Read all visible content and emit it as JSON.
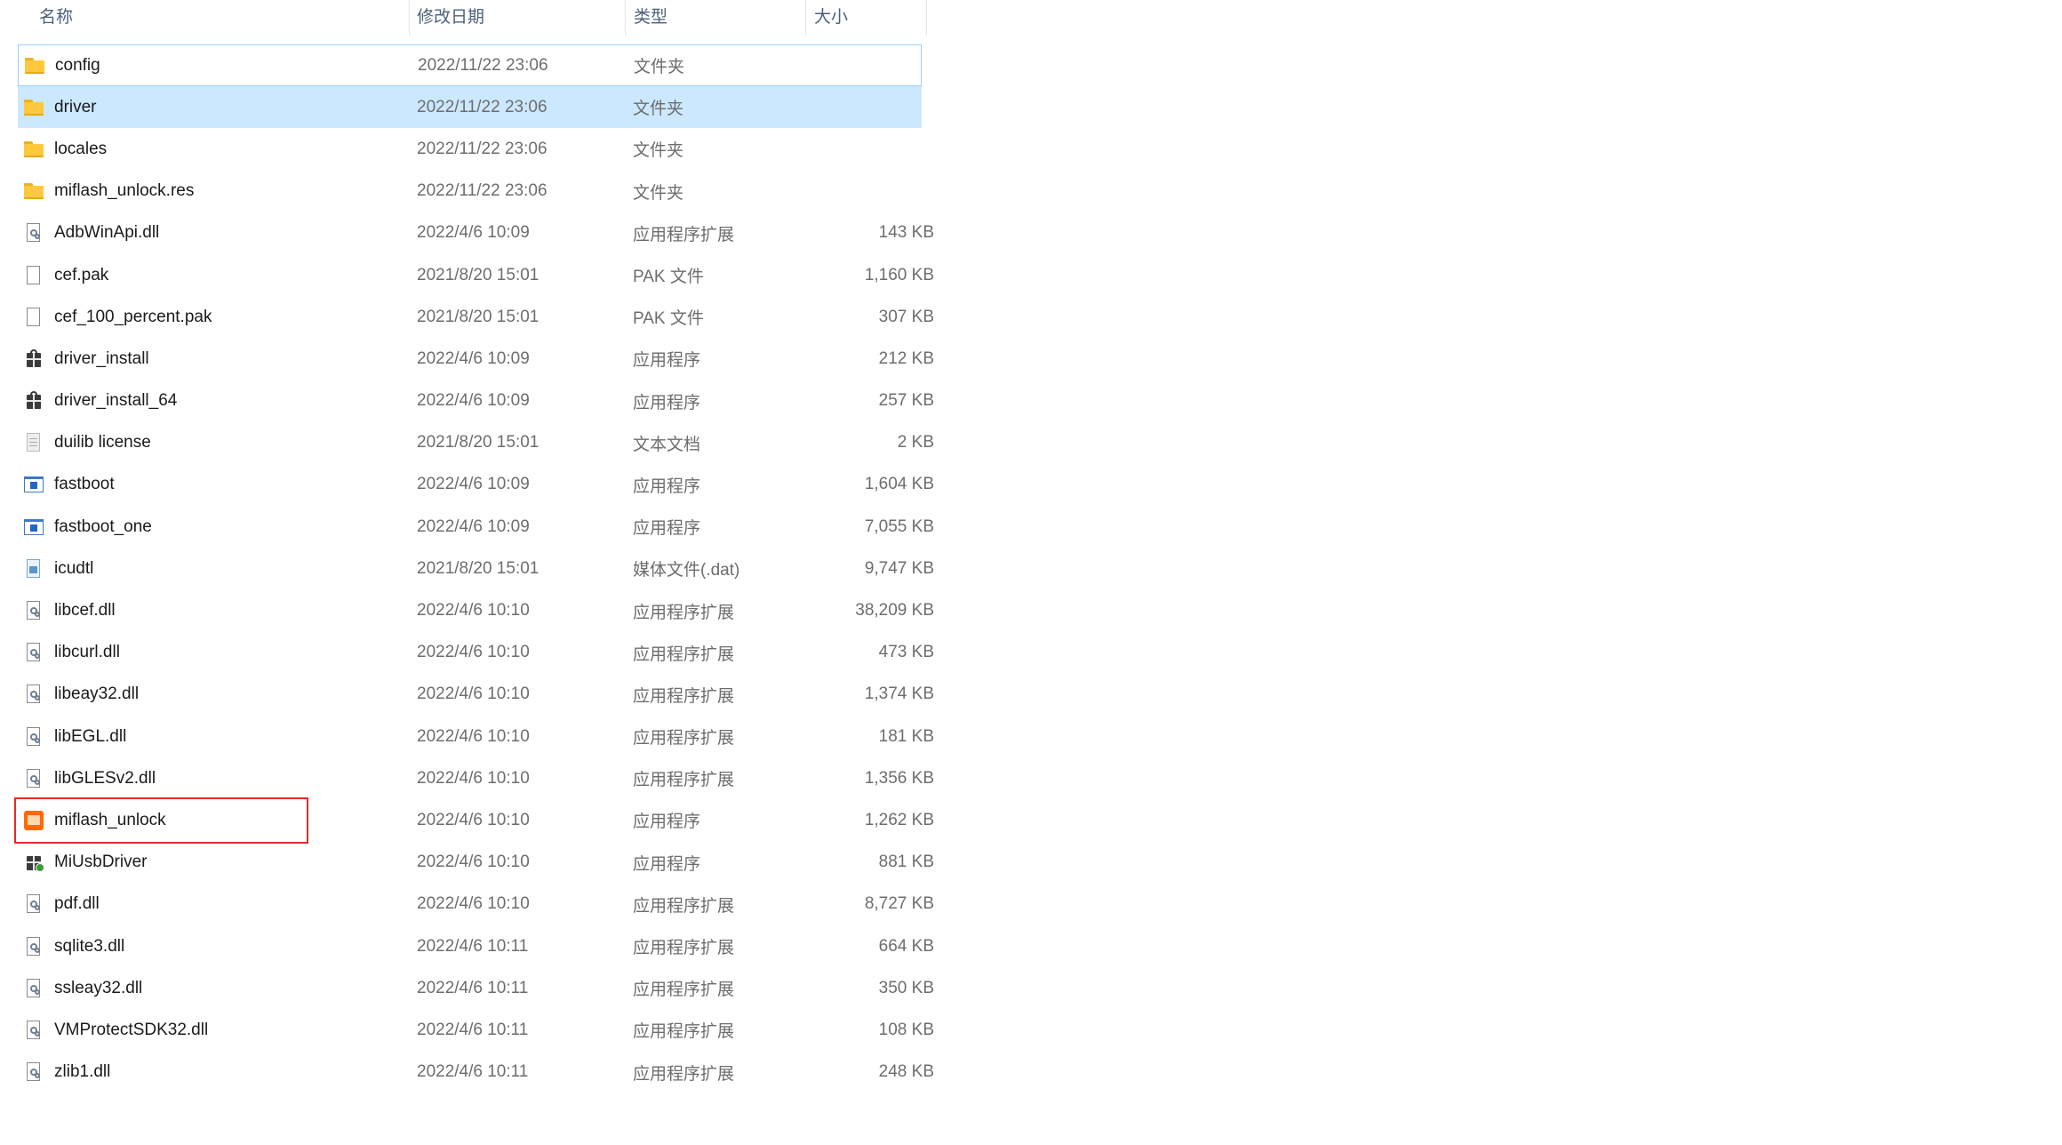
{
  "header": {
    "name": "名称",
    "date": "修改日期",
    "type": "类型",
    "size": "大小",
    "sort_arrow": "^"
  },
  "files": [
    {
      "name": "config",
      "date": "2022/11/22 23:06",
      "type": "文件夹",
      "size": "",
      "icon": "folder-icon",
      "state": "focus"
    },
    {
      "name": "driver",
      "date": "2022/11/22 23:06",
      "type": "文件夹",
      "size": "",
      "icon": "folder-icon",
      "state": "selected"
    },
    {
      "name": "locales",
      "date": "2022/11/22 23:06",
      "type": "文件夹",
      "size": "",
      "icon": "folder-icon",
      "state": ""
    },
    {
      "name": "miflash_unlock.res",
      "date": "2022/11/22 23:06",
      "type": "文件夹",
      "size": "",
      "icon": "folder-icon",
      "state": ""
    },
    {
      "name": "AdbWinApi.dll",
      "date": "2022/4/6 10:09",
      "type": "应用程序扩展",
      "size": "143 KB",
      "icon": "dll-icon",
      "state": ""
    },
    {
      "name": "cef.pak",
      "date": "2021/8/20 15:01",
      "type": "PAK 文件",
      "size": "1,160 KB",
      "icon": "file-icon",
      "state": ""
    },
    {
      "name": "cef_100_percent.pak",
      "date": "2021/8/20 15:01",
      "type": "PAK 文件",
      "size": "307 KB",
      "icon": "file-icon",
      "state": ""
    },
    {
      "name": "driver_install",
      "date": "2022/4/6 10:09",
      "type": "应用程序",
      "size": "212 KB",
      "icon": "installer-icon",
      "state": ""
    },
    {
      "name": "driver_install_64",
      "date": "2022/4/6 10:09",
      "type": "应用程序",
      "size": "257 KB",
      "icon": "installer-icon",
      "state": ""
    },
    {
      "name": "duilib license",
      "date": "2021/8/20 15:01",
      "type": "文本文档",
      "size": "2 KB",
      "icon": "text-file-icon",
      "state": ""
    },
    {
      "name": "fastboot",
      "date": "2022/4/6 10:09",
      "type": "应用程序",
      "size": "1,604 KB",
      "icon": "app-window-icon",
      "state": ""
    },
    {
      "name": "fastboot_one",
      "date": "2022/4/6 10:09",
      "type": "应用程序",
      "size": "7,055 KB",
      "icon": "app-window-icon",
      "state": ""
    },
    {
      "name": "icudtl",
      "date": "2021/8/20 15:01",
      "type": "媒体文件(.dat)",
      "size": "9,747 KB",
      "icon": "media-file-icon",
      "state": ""
    },
    {
      "name": "libcef.dll",
      "date": "2022/4/6 10:10",
      "type": "应用程序扩展",
      "size": "38,209 KB",
      "icon": "dll-icon",
      "state": ""
    },
    {
      "name": "libcurl.dll",
      "date": "2022/4/6 10:10",
      "type": "应用程序扩展",
      "size": "473 KB",
      "icon": "dll-icon",
      "state": ""
    },
    {
      "name": "libeay32.dll",
      "date": "2022/4/6 10:10",
      "type": "应用程序扩展",
      "size": "1,374 KB",
      "icon": "dll-icon",
      "state": ""
    },
    {
      "name": "libEGL.dll",
      "date": "2022/4/6 10:10",
      "type": "应用程序扩展",
      "size": "181 KB",
      "icon": "dll-icon",
      "state": ""
    },
    {
      "name": "libGLESv2.dll",
      "date": "2022/4/6 10:10",
      "type": "应用程序扩展",
      "size": "1,356 KB",
      "icon": "dll-icon",
      "state": ""
    },
    {
      "name": "miflash_unlock",
      "date": "2022/4/6 10:10",
      "type": "应用程序",
      "size": "1,262 KB",
      "icon": "mi-app-icon",
      "state": "highlighted"
    },
    {
      "name": "MiUsbDriver",
      "date": "2022/4/6 10:10",
      "type": "应用程序",
      "size": "881 KB",
      "icon": "usb-driver-icon",
      "state": ""
    },
    {
      "name": "pdf.dll",
      "date": "2022/4/6 10:10",
      "type": "应用程序扩展",
      "size": "8,727 KB",
      "icon": "dll-icon",
      "state": ""
    },
    {
      "name": "sqlite3.dll",
      "date": "2022/4/6 10:11",
      "type": "应用程序扩展",
      "size": "664 KB",
      "icon": "dll-icon",
      "state": ""
    },
    {
      "name": "ssleay32.dll",
      "date": "2022/4/6 10:11",
      "type": "应用程序扩展",
      "size": "350 KB",
      "icon": "dll-icon",
      "state": ""
    },
    {
      "name": "VMProtectSDK32.dll",
      "date": "2022/4/6 10:11",
      "type": "应用程序扩展",
      "size": "108 KB",
      "icon": "dll-icon",
      "state": ""
    },
    {
      "name": "zlib1.dll",
      "date": "2022/4/6 10:11",
      "type": "应用程序扩展",
      "size": "248 KB",
      "icon": "dll-icon",
      "state": ""
    }
  ],
  "colors": {
    "selection": "#cce8ff",
    "focus_border": "#99d1ff",
    "highlight_box": "#e5282a",
    "header_text": "#4c607a"
  }
}
